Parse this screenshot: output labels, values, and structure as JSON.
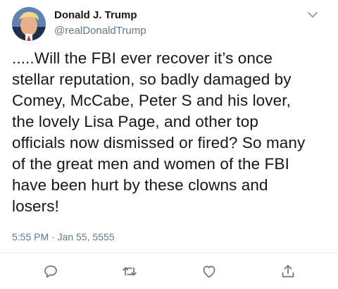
{
  "author": {
    "name": "Donald J. Trump",
    "handle": "@realDonaldTrump"
  },
  "tweet": {
    "text": ".....Will the FBI ever recover it’s once\nstellar reputation, so badly damaged by\nComey, McCabe, Peter S and his lover,\nthe lovely Lisa Page, and other top\nofficials now dismissed or fired? So many\nof the great men and women of the FBI\nhave been hurt by these clowns and\nlosers!",
    "timestamp": "5:55 PM · Jan 55, 5555"
  },
  "actions": {
    "icons": [
      "reply-icon",
      "retweet-icon",
      "like-icon",
      "share-icon"
    ]
  },
  "colors": {
    "text": "#14171a",
    "secondary": "#657786",
    "divider": "#e6ecf0"
  }
}
